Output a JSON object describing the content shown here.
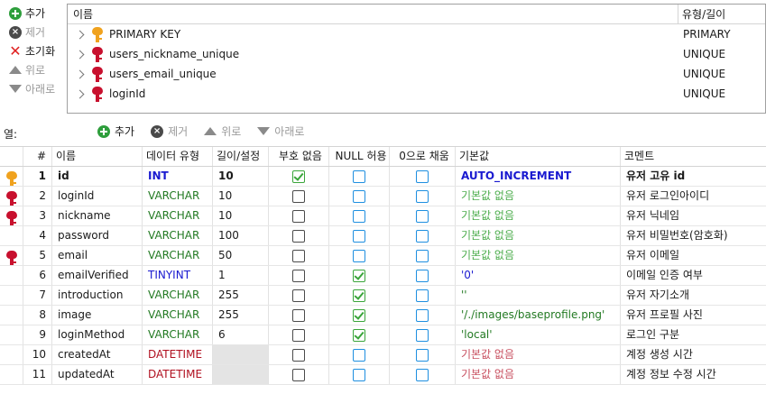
{
  "index_buttons": {
    "add": "추가",
    "remove": "제거",
    "clear": "초기화",
    "up": "위로",
    "down": "아래로"
  },
  "index_list": {
    "headers": {
      "name": "이름",
      "type": "유형/길이"
    },
    "rows": [
      {
        "name": "PRIMARY KEY",
        "type": "PRIMARY",
        "key": "gold"
      },
      {
        "name": "users_nickname_unique",
        "type": "UNIQUE",
        "key": "red"
      },
      {
        "name": "users_email_unique",
        "type": "UNIQUE",
        "key": "red"
      },
      {
        "name": "loginId",
        "type": "UNIQUE",
        "key": "red"
      }
    ]
  },
  "columns_toolbar": {
    "label": "열:",
    "add": "추가",
    "remove": "제거",
    "up": "위로",
    "down": "아래로"
  },
  "grid": {
    "headers": {
      "num": "#",
      "name": "이름",
      "type": "데이터 유형",
      "length": "길이/설정",
      "unsigned": "부호 없음",
      "null": "NULL 허용",
      "zerofill": "0으로 채움",
      "default": "기본값",
      "comment": "코멘트"
    },
    "rows": [
      {
        "num": "1",
        "name": "id",
        "type": "INT",
        "type_style": "first",
        "length": "10",
        "unsigned": true,
        "null": false,
        "zerofill": false,
        "default": "AUTO_INCREMENT",
        "default_style": "auto",
        "comment": "유저 고유 id",
        "key": "gold"
      },
      {
        "num": "2",
        "name": "loginId",
        "type": "VARCHAR",
        "type_style": "green",
        "length": "10",
        "unsigned": false,
        "null": false,
        "zerofill": false,
        "default": "기본값 없음",
        "default_style": "none-green",
        "comment": "유저 로그인아이디",
        "key": "red"
      },
      {
        "num": "3",
        "name": "nickname",
        "type": "VARCHAR",
        "type_style": "green",
        "length": "10",
        "unsigned": false,
        "null": false,
        "zerofill": false,
        "default": "기본값 없음",
        "default_style": "none-green",
        "comment": "유저 닉네임",
        "key": "red"
      },
      {
        "num": "4",
        "name": "password",
        "type": "VARCHAR",
        "type_style": "green",
        "length": "100",
        "unsigned": false,
        "null": false,
        "zerofill": false,
        "default": "기본값 없음",
        "default_style": "none-green",
        "comment": "유저 비밀번호(암호화)",
        "key": ""
      },
      {
        "num": "5",
        "name": "email",
        "type": "VARCHAR",
        "type_style": "green",
        "length": "50",
        "unsigned": false,
        "null": false,
        "zerofill": false,
        "default": "기본값 없음",
        "default_style": "none-green",
        "comment": "유저 이메일",
        "key": "red"
      },
      {
        "num": "6",
        "name": "emailVerified",
        "type": "TINYINT",
        "type_style": "blue",
        "length": "1",
        "unsigned": false,
        "null": true,
        "zerofill": false,
        "default": "'0'",
        "default_style": "blue",
        "comment": "이메일 인증 여부",
        "key": ""
      },
      {
        "num": "7",
        "name": "introduction",
        "type": "VARCHAR",
        "type_style": "green",
        "length": "255",
        "unsigned": false,
        "null": true,
        "zerofill": false,
        "default": "''",
        "default_style": "green",
        "comment": "유저 자기소개",
        "key": ""
      },
      {
        "num": "8",
        "name": "image",
        "type": "VARCHAR",
        "type_style": "green",
        "length": "255",
        "unsigned": false,
        "null": true,
        "zerofill": false,
        "default": "'/./images/baseprofile.png'",
        "default_style": "green",
        "comment": "유저 프로필 사진",
        "key": ""
      },
      {
        "num": "9",
        "name": "loginMethod",
        "type": "VARCHAR",
        "type_style": "green",
        "length": "6",
        "unsigned": false,
        "null": true,
        "zerofill": false,
        "default": "'local'",
        "default_style": "green",
        "comment": "로그인 구분",
        "key": ""
      },
      {
        "num": "10",
        "name": "createdAt",
        "type": "DATETIME",
        "type_style": "red",
        "length": "",
        "unsigned": false,
        "null": false,
        "zerofill": false,
        "default": "기본값 없음",
        "default_style": "none-red",
        "comment": "계정 생성 시간",
        "key": ""
      },
      {
        "num": "11",
        "name": "updatedAt",
        "type": "DATETIME",
        "type_style": "red",
        "length": "",
        "unsigned": false,
        "null": false,
        "zerofill": false,
        "default": "기본값 없음",
        "default_style": "none-red",
        "comment": "계정 정보 수정 시간",
        "key": ""
      }
    ]
  }
}
